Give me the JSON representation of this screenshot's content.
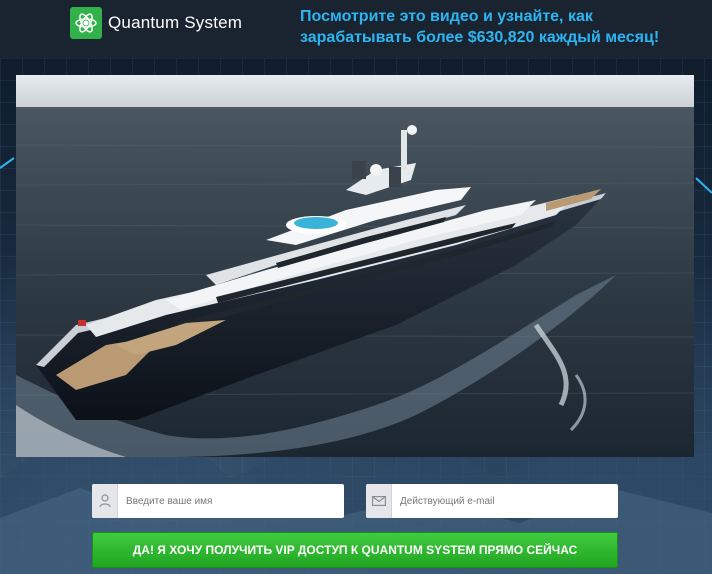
{
  "header": {
    "brand_name": "Quantum System",
    "headline": "Посмотрите это видео и узнайте, как зарабатывать более $630,820 каждый месяц!"
  },
  "form": {
    "name_placeholder": "Введите ваше имя",
    "email_placeholder": "Действующий e-mail",
    "submit_label": "ДА! Я ХОЧУ ПОЛУЧИТЬ VIP ДОСТУП К QUANTUM SYSTEM ПРЯМО СЕЙЧАС"
  },
  "icons": {
    "logo": "atom-icon",
    "name_field": "user-icon",
    "email_field": "envelope-icon"
  },
  "colors": {
    "headline": "#2bb5f2",
    "logo_green": "#32b04a",
    "submit_green": "#2bb52b"
  }
}
